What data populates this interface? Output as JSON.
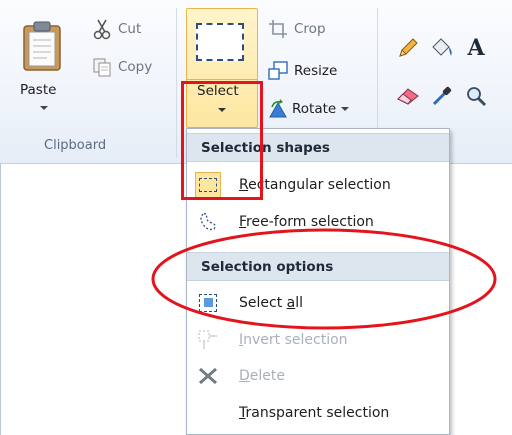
{
  "clipboard": {
    "paste_label": "Paste",
    "cut_label": "Cut",
    "copy_label": "Copy",
    "group_label": "Clipboard"
  },
  "image": {
    "select_label": "Select",
    "crop_label": "Crop",
    "resize_label": "Resize",
    "rotate_label": "Rotate"
  },
  "tools": {
    "icons": [
      "pencil-icon",
      "fill-icon",
      "text-icon",
      "eraser-icon",
      "color-picker-icon",
      "magnifier-icon"
    ]
  },
  "menu": {
    "section1": "Selection shapes",
    "rect_pre": "",
    "rect_ul": "R",
    "rect_post": "ectangular selection",
    "free_pre": "",
    "free_ul": "F",
    "free_post": "ree-form selection",
    "section2": "Selection options",
    "selall_pre": "Select ",
    "selall_ul": "a",
    "selall_post": "ll",
    "invert_pre": "",
    "invert_ul": "I",
    "invert_post": "nvert selection",
    "delete_pre": "",
    "delete_ul": "D",
    "delete_post": "elete",
    "transp_pre": "",
    "transp_ul": "T",
    "transp_post": "ransparent selection"
  },
  "colors": {
    "annotation": "#e3141b",
    "hover_fill": "#fde6a0",
    "hover_border": "#e7b54a"
  }
}
